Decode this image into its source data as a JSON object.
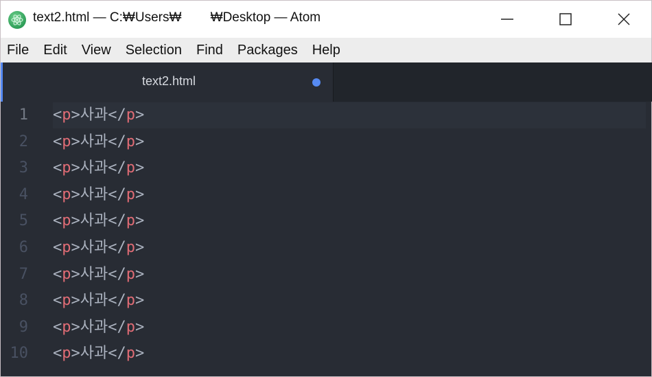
{
  "window": {
    "title": "text2.html — C:₩Users₩        ₩Desktop — Atom",
    "app_icon": "atom-logo-icon",
    "controls": [
      "minimize-icon",
      "maximize-icon",
      "close-icon"
    ]
  },
  "menu": [
    "File",
    "Edit",
    "View",
    "Selection",
    "Find",
    "Packages",
    "Help"
  ],
  "tabs": [
    {
      "label": "text2.html",
      "modified": true,
      "active": true
    }
  ],
  "colors": {
    "accent": "#568af2",
    "tag": "#e06c75",
    "text": "#abb2bf",
    "editor_bg": "#282c34"
  },
  "editor": {
    "cursor_line": 1,
    "lines": [
      {
        "num": "1",
        "open_lt": "<",
        "open_tag": "p",
        "open_gt": ">",
        "text": "사과",
        "close_lt": "</",
        "close_tag": "p",
        "close_gt": ">"
      },
      {
        "num": "2",
        "open_lt": "<",
        "open_tag": "p",
        "open_gt": ">",
        "text": "사과",
        "close_lt": "</",
        "close_tag": "p",
        "close_gt": ">"
      },
      {
        "num": "3",
        "open_lt": "<",
        "open_tag": "p",
        "open_gt": ">",
        "text": "사과",
        "close_lt": "</",
        "close_tag": "p",
        "close_gt": ">"
      },
      {
        "num": "4",
        "open_lt": "<",
        "open_tag": "p",
        "open_gt": ">",
        "text": "사과",
        "close_lt": "</",
        "close_tag": "p",
        "close_gt": ">"
      },
      {
        "num": "5",
        "open_lt": "<",
        "open_tag": "p",
        "open_gt": ">",
        "text": "사과",
        "close_lt": "</",
        "close_tag": "p",
        "close_gt": ">"
      },
      {
        "num": "6",
        "open_lt": "<",
        "open_tag": "p",
        "open_gt": ">",
        "text": "사과",
        "close_lt": "</",
        "close_tag": "p",
        "close_gt": ">"
      },
      {
        "num": "7",
        "open_lt": "<",
        "open_tag": "p",
        "open_gt": ">",
        "text": "사과",
        "close_lt": "</",
        "close_tag": "p",
        "close_gt": ">"
      },
      {
        "num": "8",
        "open_lt": "<",
        "open_tag": "p",
        "open_gt": ">",
        "text": "사과",
        "close_lt": "</",
        "close_tag": "p",
        "close_gt": ">"
      },
      {
        "num": "9",
        "open_lt": "<",
        "open_tag": "p",
        "open_gt": ">",
        "text": "사과",
        "close_lt": "</",
        "close_tag": "p",
        "close_gt": ">"
      },
      {
        "num": "10",
        "open_lt": "<",
        "open_tag": "p",
        "open_gt": ">",
        "text": "사과",
        "close_lt": "</",
        "close_tag": "p",
        "close_gt": ">"
      }
    ]
  }
}
